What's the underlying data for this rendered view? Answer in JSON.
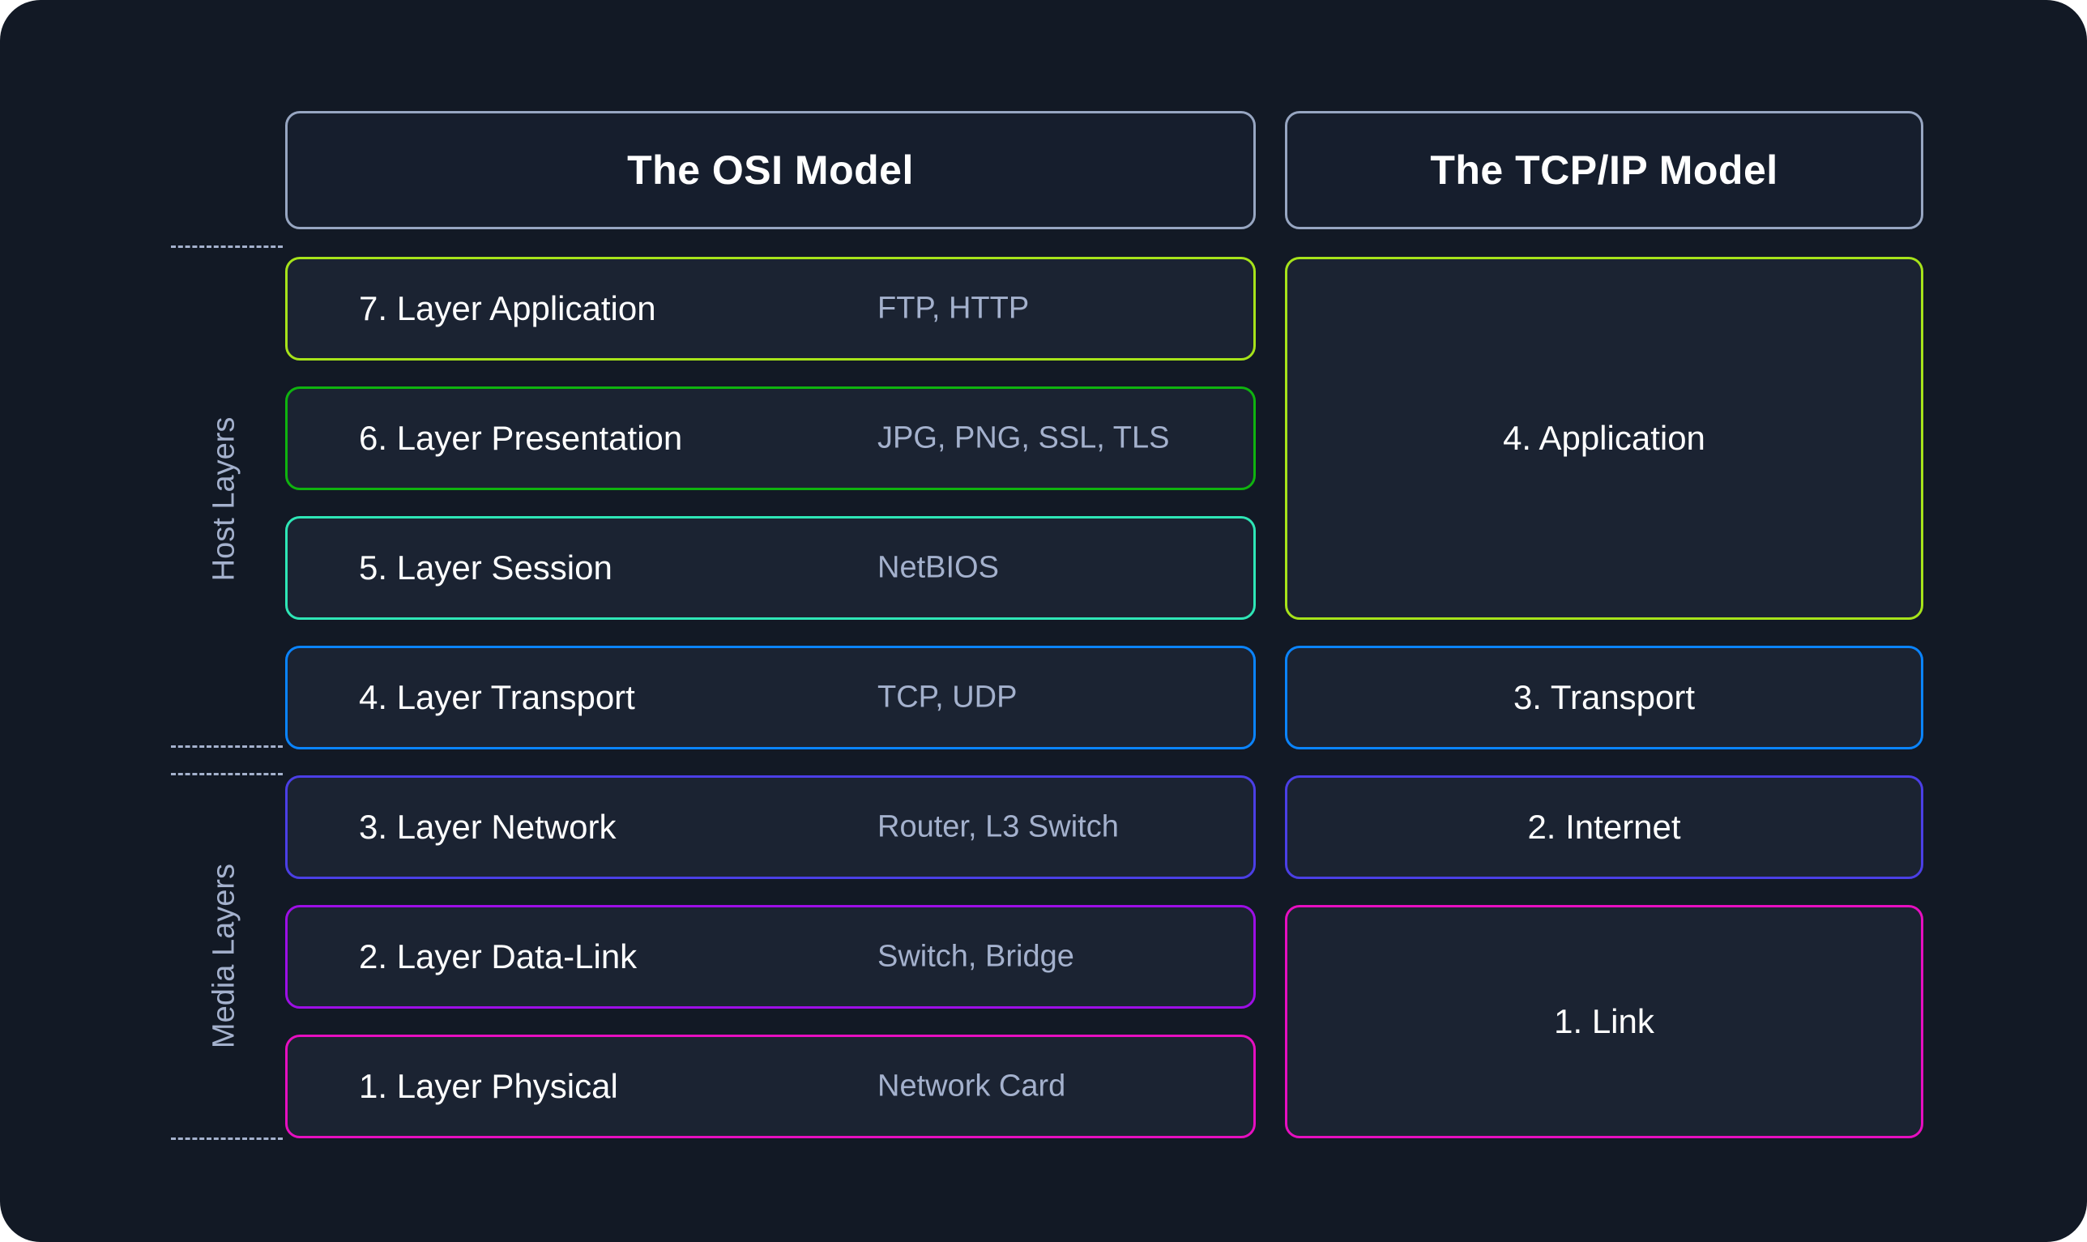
{
  "headers": {
    "osi_title": "The OSI Model",
    "tcpip_title": "The TCP/IP Model"
  },
  "side_labels": {
    "host": "Host Layers",
    "media": "Media Layers"
  },
  "osi_layers": [
    {
      "label": "7. Layer Application",
      "protocols": "FTP, HTTP",
      "color": "#a6e31a"
    },
    {
      "label": "6. Layer Presentation",
      "protocols": "JPG, PNG, SSL, TLS",
      "color": "#0fb30f"
    },
    {
      "label": "5. Layer Session",
      "protocols": "NetBIOS",
      "color": "#2ee6b6"
    },
    {
      "label": "4. Layer Transport",
      "protocols": "TCP, UDP",
      "color": "#0a84ff"
    },
    {
      "label": "3. Layer Network",
      "protocols": "Router, L3 Switch",
      "color": "#4b3fe6"
    },
    {
      "label": "2. Layer Data-Link",
      "protocols": "Switch, Bridge",
      "color": "#9d0fe6"
    },
    {
      "label": "1. Layer Physical",
      "protocols": "Network Card",
      "color": "#e60fc0"
    }
  ],
  "tcpip_layers": [
    {
      "label": "4. Application",
      "color": "#a6e31a",
      "spans_osi_layers": [
        7,
        6,
        5
      ]
    },
    {
      "label": "3. Transport",
      "color": "#0a84ff",
      "spans_osi_layers": [
        4
      ]
    },
    {
      "label": "2. Internet",
      "color": "#4b3fe6",
      "spans_osi_layers": [
        3
      ]
    },
    {
      "label": "1. Link",
      "color": "#e60fc0",
      "spans_osi_layers": [
        2,
        1
      ]
    }
  ]
}
